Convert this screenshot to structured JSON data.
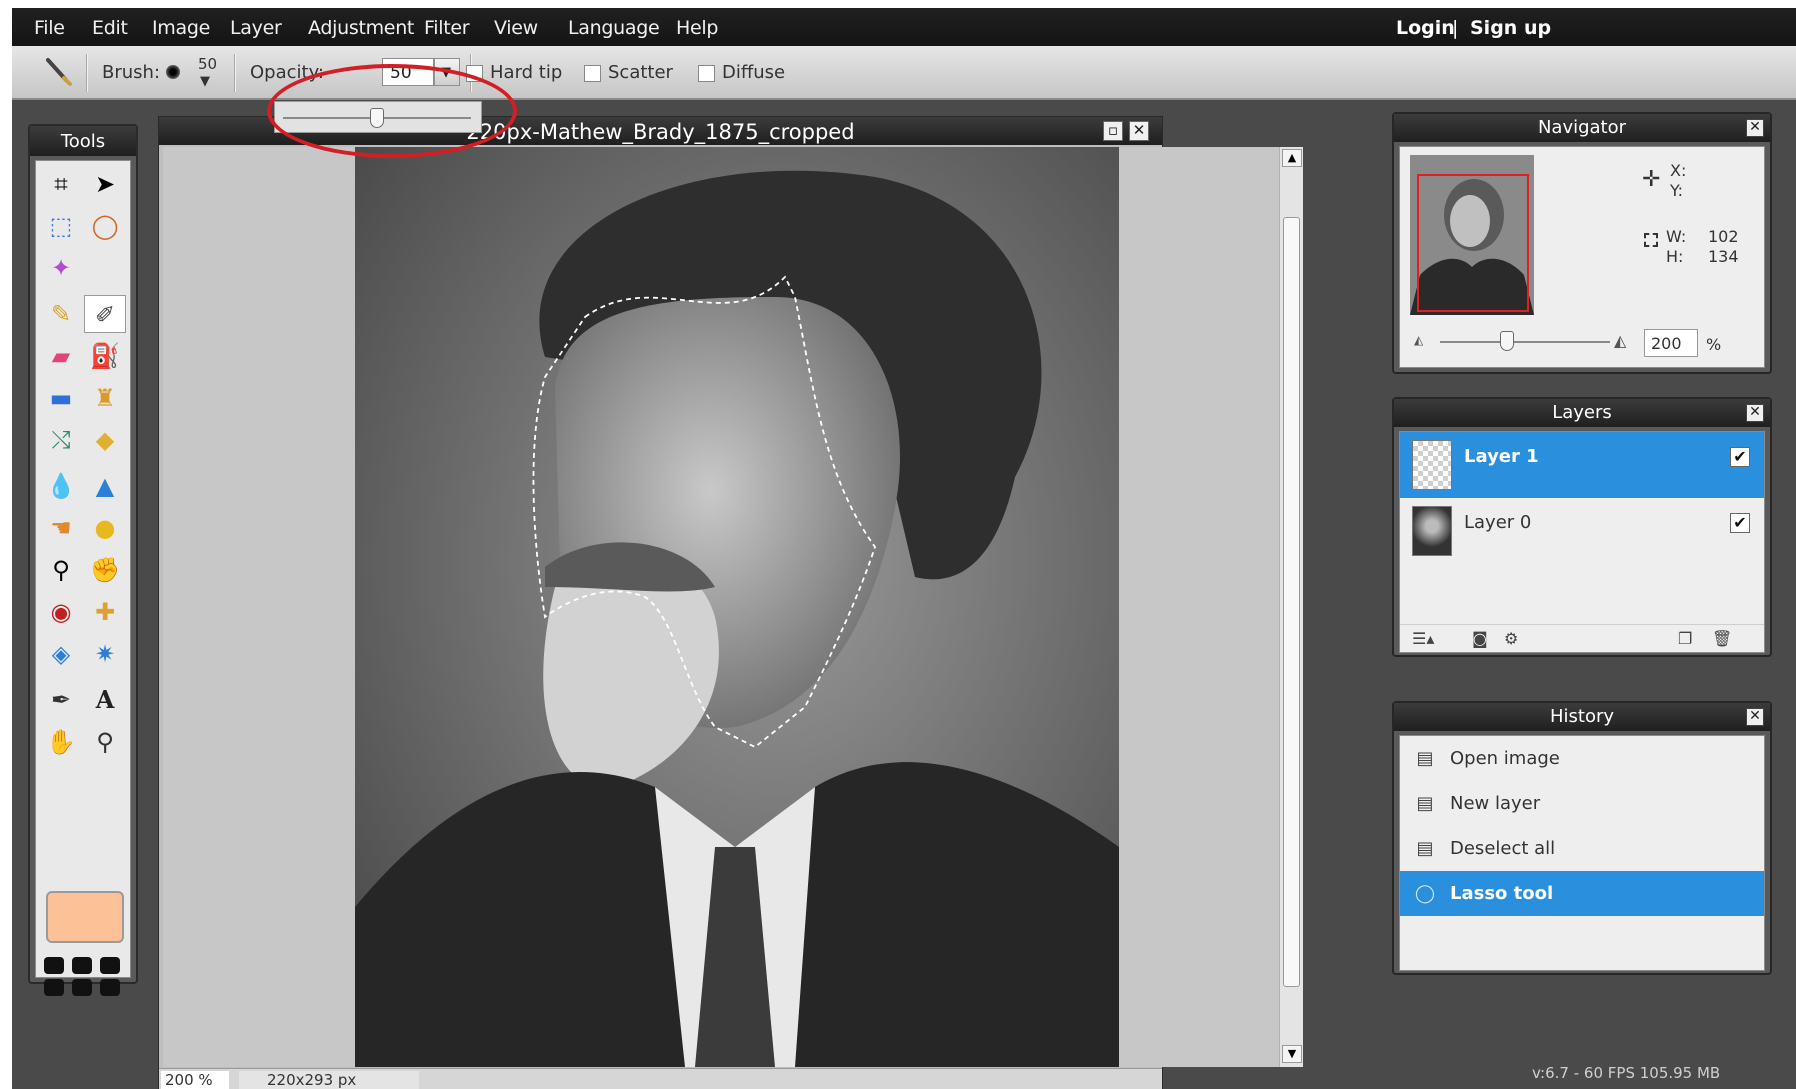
{
  "menubar": {
    "items": [
      "File",
      "Edit",
      "Image",
      "Layer",
      "Adjustment",
      "Filter",
      "View",
      "Language",
      "Help"
    ],
    "login": "Login",
    "separator": "|",
    "signup": "Sign up"
  },
  "options": {
    "brush_label": "Brush:",
    "brush_size": "50",
    "opacity_label": "Opacity:",
    "opacity_value": "50",
    "opacity_slider_fraction": 0.5,
    "hard_tip": "Hard tip",
    "scatter": "Scatter",
    "diffuse": "Diffuse",
    "highlight_color": "#d21f26"
  },
  "tools": {
    "title": "Tools",
    "icons": [
      "crop-icon",
      "move-icon",
      "rect-select-icon",
      "lasso-icon",
      "magic-wand-icon",
      "pencil-icon",
      "brush-icon",
      "eraser-icon",
      "bucket-icon",
      "gradient-icon",
      "clone-stamp-icon",
      "color-replace-icon",
      "shape-icon",
      "drop-icon",
      "sharpen-icon",
      "smudge-icon",
      "sponge-icon",
      "zoom-lens-icon",
      "burn-icon",
      "red-eye-icon",
      "spot-heal-icon",
      "bloat-icon",
      "pinch-icon",
      "picker-icon",
      "text-icon",
      "hand-icon",
      "zoom-icon"
    ],
    "foreground_color": "#fdc198"
  },
  "document": {
    "title": "220px-Mathew_Brady_1875_cropped",
    "zoom": "200 %",
    "size": "220x293 px"
  },
  "navigator": {
    "title": "Navigator",
    "x_label": "X:",
    "y_label": "Y:",
    "w_label": "W:",
    "w_value": "102",
    "h_label": "H:",
    "h_value": "134",
    "zoom_value": "200",
    "zoom_unit": "%"
  },
  "layers": {
    "title": "Layers",
    "items": [
      {
        "name": "Layer 1",
        "visible": true,
        "selected": true
      },
      {
        "name": "Layer 0",
        "visible": true,
        "selected": false
      }
    ]
  },
  "history": {
    "title": "History",
    "items": [
      {
        "label": "Open image",
        "selected": false
      },
      {
        "label": "New layer",
        "selected": false
      },
      {
        "label": "Deselect all",
        "selected": false
      },
      {
        "label": "Lasso tool",
        "selected": true
      }
    ]
  },
  "accent_color": "#2a8fdd",
  "footer": {
    "version": "v:6.7 - 60 FPS 105.95 MB"
  }
}
